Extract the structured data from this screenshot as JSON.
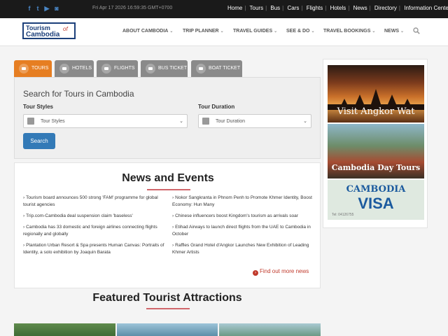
{
  "topbar": {
    "social": [
      {
        "name": "facebook-icon",
        "glyph": "f"
      },
      {
        "name": "twitter-icon",
        "glyph": "t"
      },
      {
        "name": "youtube-icon",
        "glyph": "▶"
      },
      {
        "name": "instagram-icon",
        "glyph": "◙"
      }
    ],
    "datetime": "Fri Apr 17 2026 16:59:35 GMT+0700",
    "links": [
      "Home",
      "Tours",
      "Bus",
      "Cars",
      "Flights",
      "Hotels",
      "News",
      "Directory",
      "Information Center"
    ]
  },
  "header": {
    "logo": {
      "line1": "Tourism",
      "line2": "Cambodia",
      "line3": "of"
    },
    "nav": [
      "ABOUT CAMBODIA",
      "TRIP PLANNER",
      "TRAVEL GUIDES",
      "SEE & DO",
      "TRAVEL BOOKINGS",
      "NEWS"
    ]
  },
  "tabs": [
    "TOURS",
    "HOTELS",
    "FLIGHTS",
    "BUS TICKET",
    "BOAT TICKET"
  ],
  "search": {
    "title": "Search for Tours in Cambodia",
    "styles_label": "Tour Styles",
    "styles_value": "Tour Styles",
    "duration_label": "Tour Duration",
    "duration_value": "Tour Duration",
    "button": "Search"
  },
  "news": {
    "title": "News and Events",
    "left": [
      "Tourism board announces 500 strong 'FAM' programme for global tourist agencies",
      "Trip.com-Cambodia deal suspension claim 'baseless'",
      "Cambodia has 33 domestic and foreign airlines connecting flights regionally and globally",
      "Plantation Urban Resort & Spa presents Human Canvas: Portraits of Identity, a solo exhibition by Joaquin Barata"
    ],
    "right": [
      "Nokor Sangkranta in Phnom Penh to Promote Khmer Identity, Boost Economy: Hun Many",
      "Chinese influencers boost Kingdom's tourism as arrivals soar",
      "Etihad Airways to launch direct flights from the UAE to Cambodia in October",
      "Raffles Grand Hotel d'Angkor Launches New Exhibition of Leading Khmer Artists"
    ],
    "more": "Find out more news"
  },
  "featured": {
    "title": "Featured Tourist Attractions"
  },
  "sidebar": {
    "ad1": "Visit Angkor Wat",
    "ad2": "Cambodia Day Tours",
    "ad3_line1": "CAMBODIA",
    "ad3_line2": "VISA",
    "ad3_line3": "Tel: 04126755"
  }
}
